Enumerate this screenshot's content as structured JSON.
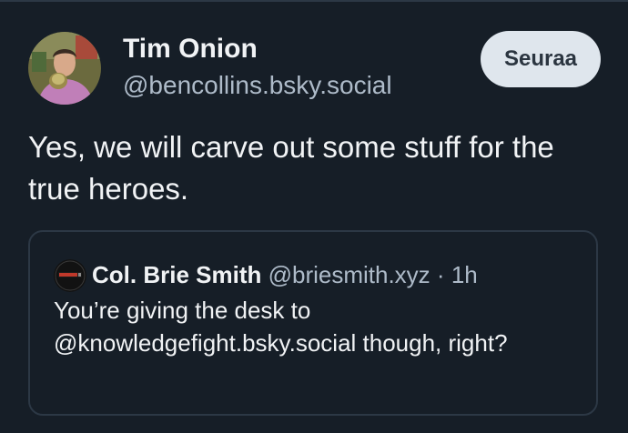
{
  "post": {
    "author": {
      "display_name": "Tim Onion",
      "handle": "@bencollins.bsky.social",
      "avatar_icon": "user-photo"
    },
    "follow_label": "Seuraa",
    "text": "Yes, we will carve out some stuff for the true heroes."
  },
  "quote": {
    "author": {
      "display_name": "Col. Brie Smith",
      "handle": "@briesmith.xyz",
      "avatar_icon": "logo-avatar"
    },
    "separator": "·",
    "time": "1h",
    "text": "You’re giving the desk to @knowledgefight.bsky.social though, right?"
  },
  "colors": {
    "background": "#161e27",
    "primary_text": "#f1f3f5",
    "secondary_text": "#aebbc9",
    "button_bg": "#dfe6ed",
    "border": "#2c3845"
  }
}
